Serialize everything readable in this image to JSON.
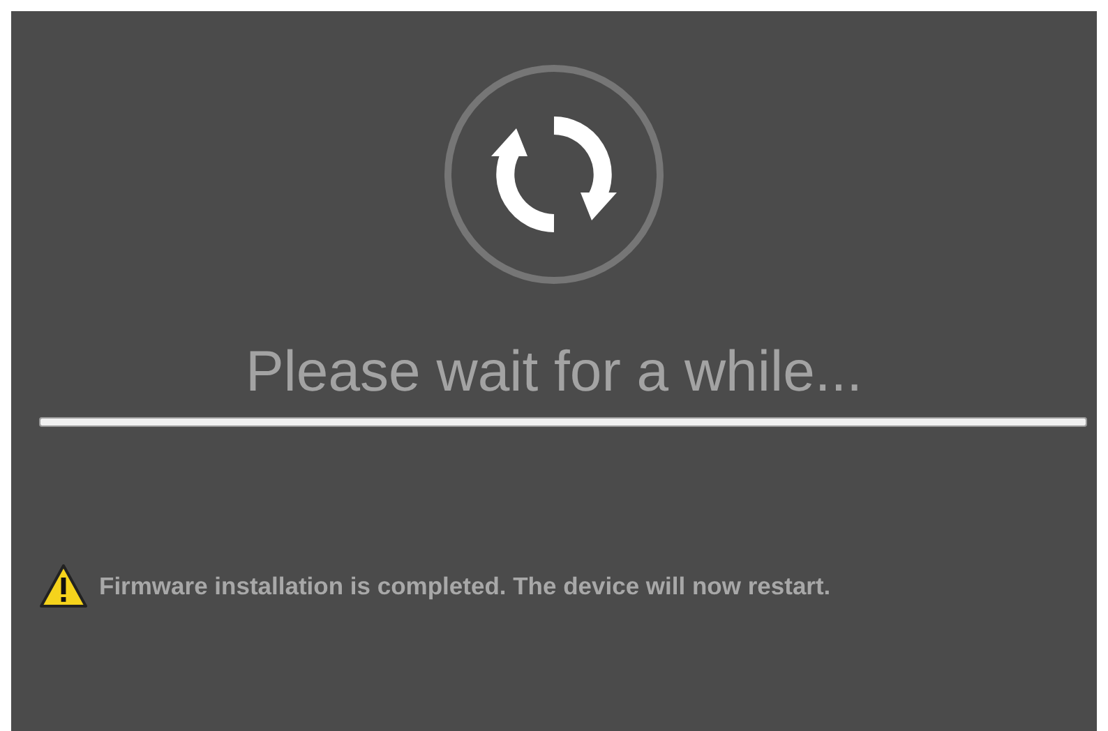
{
  "message": "Please wait for a while...",
  "progress": {
    "level": 1
  },
  "notice": {
    "text": "Firmware installation is completed. The device will now restart."
  }
}
